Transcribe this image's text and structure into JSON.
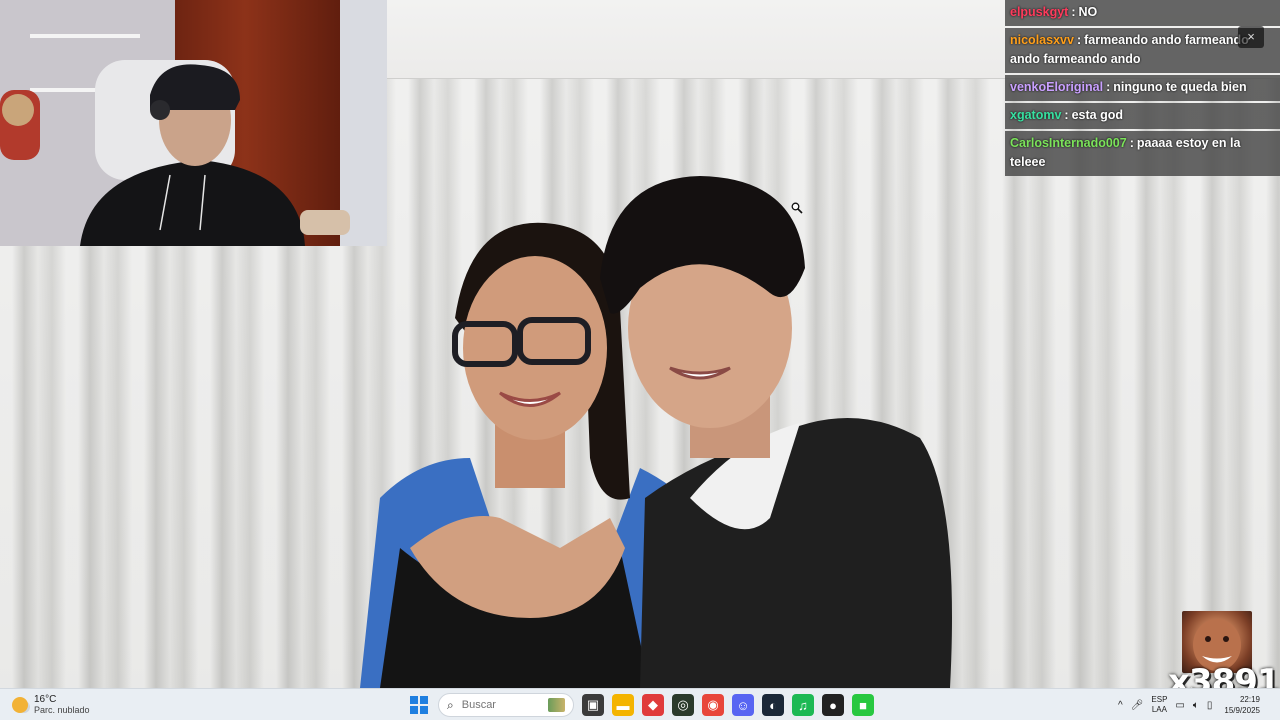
{
  "chat": {
    "messages": [
      {
        "user": "elpuskgyt",
        "text": "NO",
        "color": "#ff3b5c"
      },
      {
        "user": "nicolasxvv",
        "text": "farmeando ando farmeando ando farmeando ando",
        "color": "#ff9f1a"
      },
      {
        "user": "venkoEloriginal",
        "text": "ninguno te queda bien",
        "color": "#c9a0ff"
      },
      {
        "user": "xgatomv",
        "text": "esta god",
        "color": "#36e0a0"
      },
      {
        "user": "CarlosInternado007",
        "text": "paaaa estoy en la teleee",
        "color": "#7be35a"
      }
    ],
    "separator": ":",
    "close_icon": "×"
  },
  "overlay": {
    "code": "x3891"
  },
  "taskbar": {
    "weather": {
      "temp": "16°C",
      "desc": "Parc. nublado"
    },
    "search_placeholder": "Buscar",
    "apps": [
      {
        "name": "task-view-icon",
        "glyph": "▣",
        "bg": "#3b3b3b"
      },
      {
        "name": "file-explorer-icon",
        "glyph": "▬",
        "bg": "#f4b400"
      },
      {
        "name": "app-red-icon",
        "glyph": "◆",
        "bg": "#e03b3b"
      },
      {
        "name": "app-dark-circle-icon",
        "glyph": "◎",
        "bg": "#2b3a2b"
      },
      {
        "name": "chrome-icon",
        "glyph": "◉",
        "bg": "#e8463a"
      },
      {
        "name": "discord-icon",
        "glyph": "☺",
        "bg": "#5865f2"
      },
      {
        "name": "steam-icon",
        "glyph": "◐",
        "bg": "#1b2838"
      },
      {
        "name": "spotify-icon",
        "glyph": "♫",
        "bg": "#1db954"
      },
      {
        "name": "app-black-icon",
        "glyph": "●",
        "bg": "#222222"
      },
      {
        "name": "app-green-icon",
        "glyph": "■",
        "bg": "#28c840"
      }
    ],
    "lang": {
      "line1": "ESP",
      "line2": "LAA"
    },
    "clock": {
      "time": "22:19",
      "date": "15/9/2025"
    }
  }
}
